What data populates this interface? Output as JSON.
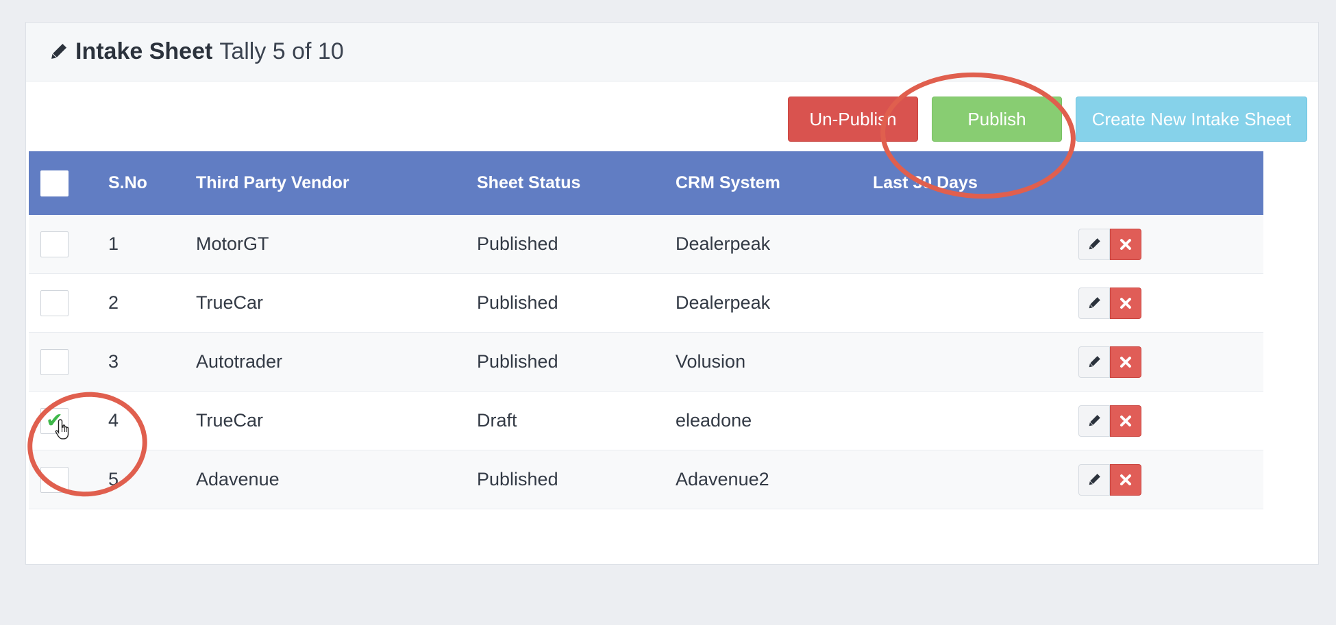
{
  "header": {
    "icon": "pencil-icon",
    "title": "Intake Sheet",
    "subtitle": "Tally 5 of 10"
  },
  "toolbar": {
    "unpublish_label": "Un-Publish",
    "publish_label": "Publish",
    "create_label": "Create New Intake Sheet"
  },
  "table": {
    "columns": [
      "S.No",
      "Third Party Vendor",
      "Sheet Status",
      "CRM System",
      "Last 30 Days"
    ],
    "rows": [
      {
        "sno": "1",
        "vendor": "MotorGT",
        "status": "Published",
        "crm": "Dealerpeak",
        "last30": "",
        "checked": false
      },
      {
        "sno": "2",
        "vendor": "TrueCar",
        "status": "Published",
        "crm": "Dealerpeak",
        "last30": "",
        "checked": false
      },
      {
        "sno": "3",
        "vendor": "Autotrader",
        "status": "Published",
        "crm": "Volusion",
        "last30": "",
        "checked": false
      },
      {
        "sno": "4",
        "vendor": "TrueCar",
        "status": "Draft",
        "crm": "eleadone",
        "last30": "",
        "checked": true
      },
      {
        "sno": "5",
        "vendor": "Adavenue",
        "status": "Published",
        "crm": "Adavenue2",
        "last30": "",
        "checked": false
      }
    ]
  },
  "colors": {
    "header_bg": "#617dc3",
    "unpublish": "#d9534f",
    "publish": "#88cd72",
    "create": "#86d2ea",
    "annotation": "#e05f4e"
  }
}
